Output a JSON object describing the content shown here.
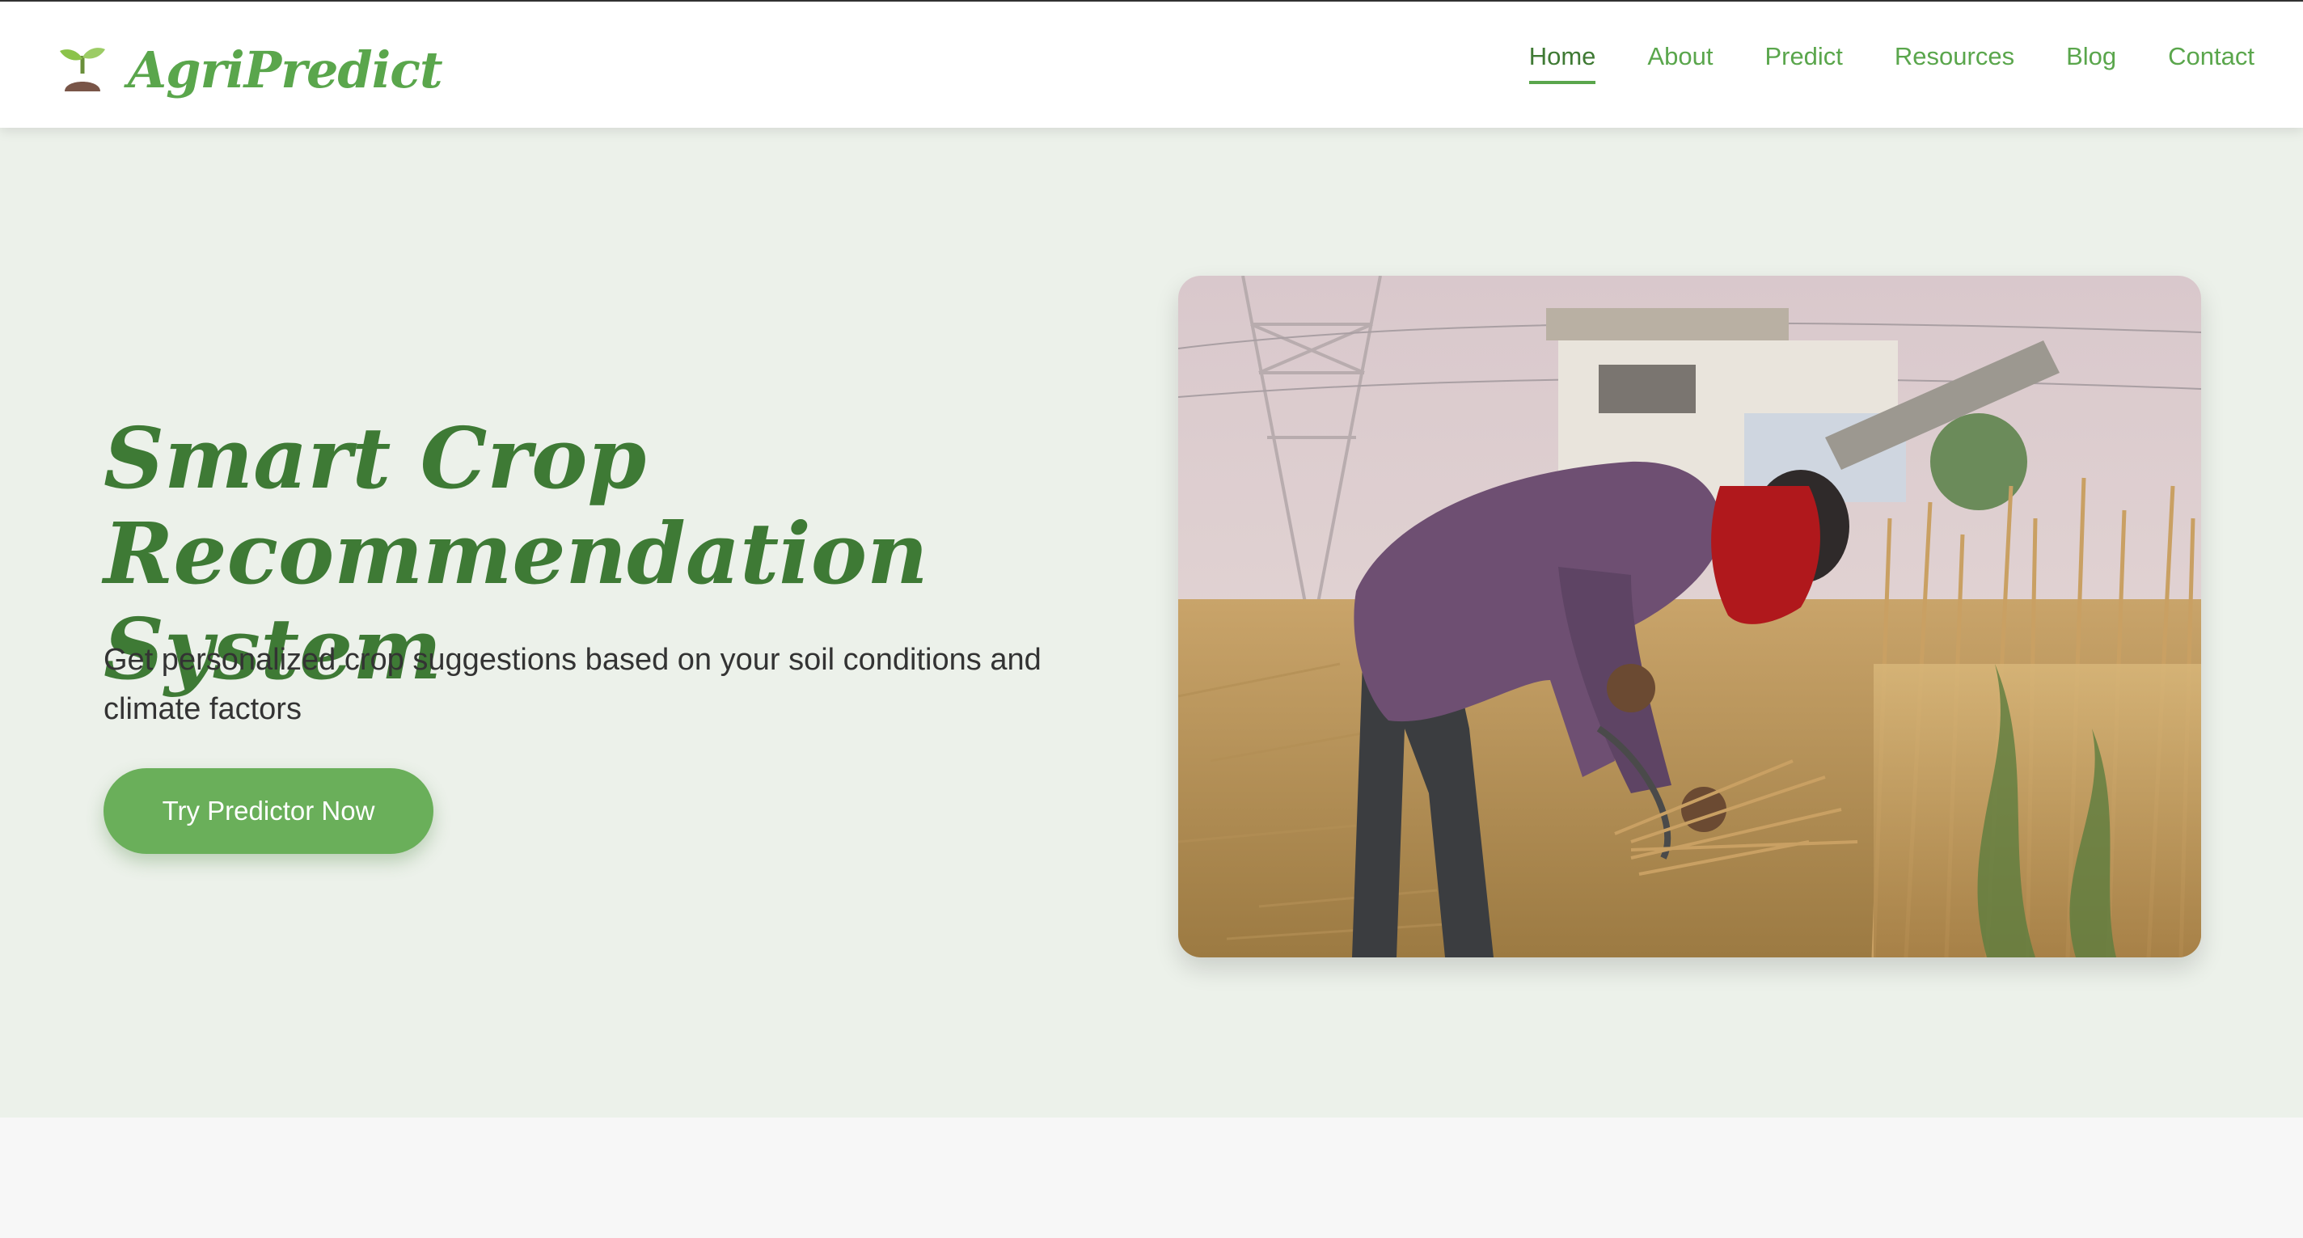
{
  "brand": {
    "name": "AgriPredict",
    "icon": "sprout-icon"
  },
  "nav": {
    "items": [
      {
        "label": "Home",
        "active": true
      },
      {
        "label": "About",
        "active": false
      },
      {
        "label": "Predict",
        "active": false
      },
      {
        "label": "Resources",
        "active": false
      },
      {
        "label": "Blog",
        "active": false
      },
      {
        "label": "Contact",
        "active": false
      }
    ]
  },
  "hero": {
    "title_line1": "Smart Crop",
    "title_line2": "Recommendation System",
    "subtitle": "Get personalized crop suggestions based on your soil conditions and climate factors",
    "cta_label": "Try Predictor Now",
    "image": "farmer-harvesting-wheat-photo"
  },
  "colors": {
    "accent": "#5aa64c",
    "accent_dark": "#3e7a35",
    "hero_bg": "#ecf1ea",
    "cta_bg": "#6aaf5a"
  }
}
